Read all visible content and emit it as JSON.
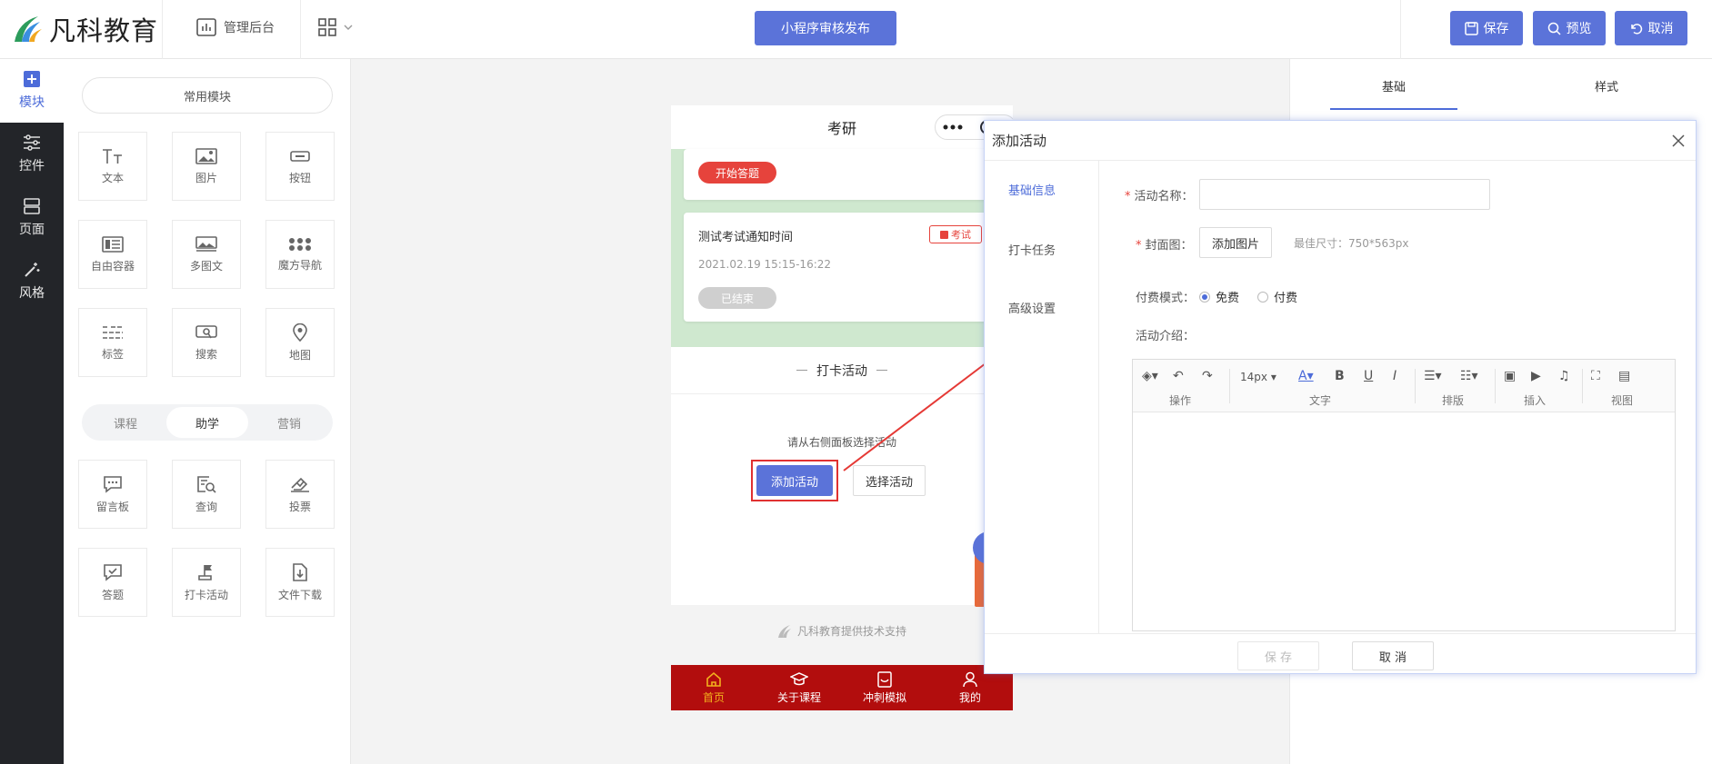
{
  "header": {
    "logo_text": "凡科教育",
    "admin_label": "管理后台",
    "publish_label": "小程序审核发布",
    "save_label": "保存",
    "preview_label": "预览",
    "cancel_label": "取消",
    "accent_color": "#5b73d9"
  },
  "rail": {
    "items": [
      {
        "label": "模块",
        "icon": "plus-square-icon",
        "active": true
      },
      {
        "label": "控件",
        "icon": "sliders-icon"
      },
      {
        "label": "页面",
        "icon": "layout-icon"
      },
      {
        "label": "风格",
        "icon": "magic-wand-icon"
      }
    ]
  },
  "modules": {
    "common_label": "常用模块",
    "common_tiles": [
      "文本",
      "图片",
      "按钮",
      "自由容器",
      "多图文",
      "魔方导航",
      "标签",
      "搜索",
      "地图"
    ],
    "tabs": [
      "课程",
      "助学",
      "营销"
    ],
    "active_tab": "助学",
    "study_tiles": [
      "留言板",
      "查询",
      "投票",
      "答题",
      "打卡活动",
      "文件下载"
    ]
  },
  "phone": {
    "title": "考研",
    "start_answer": "开始答题",
    "exam_title": "测试考试通知时间",
    "exam_tag": "考试",
    "exam_time": "2021.02.19 15:15-16:22",
    "ended": "已结束",
    "section_title": "打卡活动",
    "hint": "请从右侧面板选择活动",
    "add_activity": "添加活动",
    "select_activity": "选择活动",
    "footer": "凡科教育提供技术支持",
    "nav": [
      "首页",
      "关于课程",
      "冲刺模拟",
      "我的"
    ],
    "nav_bg": "#b20d0d"
  },
  "props": {
    "tabs": [
      "基础",
      "样式"
    ]
  },
  "dialog": {
    "title": "添加活动",
    "side": [
      "基础信息",
      "打卡任务",
      "高级设置"
    ],
    "name_label": "活动名称：",
    "name_value": "",
    "cover_label": "封面图：",
    "cover_btn": "添加图片",
    "cover_hint": "最佳尺寸：750*563px",
    "pay_label": "付费模式：",
    "pay_free": "免费",
    "pay_paid": "付费",
    "intro_label": "活动介绍：",
    "toolbar": {
      "font_size": "14px",
      "groups": [
        "操作",
        "文字",
        "排版",
        "插入",
        "视图"
      ]
    },
    "save": "保 存",
    "cancel": "取 消"
  }
}
